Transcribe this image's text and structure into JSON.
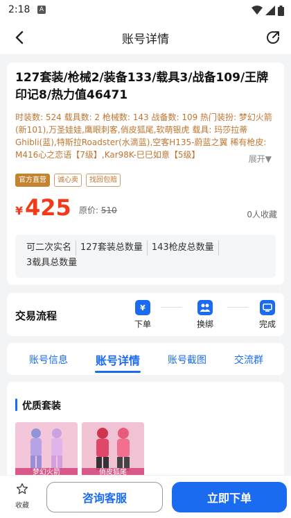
{
  "status_bar": {
    "time": "2:18",
    "notification_badge": "A"
  },
  "nav": {
    "title": "账号详情"
  },
  "listing": {
    "title": "127套装/枪械2/装备133/载具3/战备109/王牌印记8/热力值46471",
    "description": "时装数: 524 载具数: 2 枪械数: 143 战备数: 109 热门装扮: 梦幻火箭(新101),万圣娃娃,鹰眼刺客,俏皮狐尾,软萌银虎 载具: 玛莎拉蒂Ghibli(蓝),特斯拉Roadster(水滴蓝),空客H135-蔚蓝之翼 稀有枪皮: M416心之恋语【7级】,Kar98K-巳巳如意【5级】",
    "expand_label": "展开▼",
    "tags": [
      "官方直营",
      "诚心卖",
      "找回包赔"
    ],
    "currency": "¥",
    "price": "425",
    "original_price_label": "原价:",
    "original_price": "510",
    "favorites": "0人收藏",
    "features": [
      "可二次实名",
      "127套装总数量",
      "143枪皮总数量",
      "3载具总数量"
    ]
  },
  "trade_flow": {
    "title": "交易流程",
    "steps": [
      "下单",
      "换绑",
      "完成"
    ]
  },
  "tabs": [
    "账号信息",
    "账号详情",
    "账号截图",
    "交流群"
  ],
  "active_tab_index": 1,
  "detail": {
    "section_title": "优质套装",
    "skins": [
      {
        "name": "梦幻火箭"
      },
      {
        "name": "俏皮狐尾"
      }
    ]
  },
  "bottom_bar": {
    "favorite_label": "收藏",
    "consult_label": "咨询客服",
    "buy_label": "立即下单"
  },
  "colors": {
    "accent": "#1a6bf0",
    "price": "#f23a1b",
    "description": "#c0752f"
  }
}
